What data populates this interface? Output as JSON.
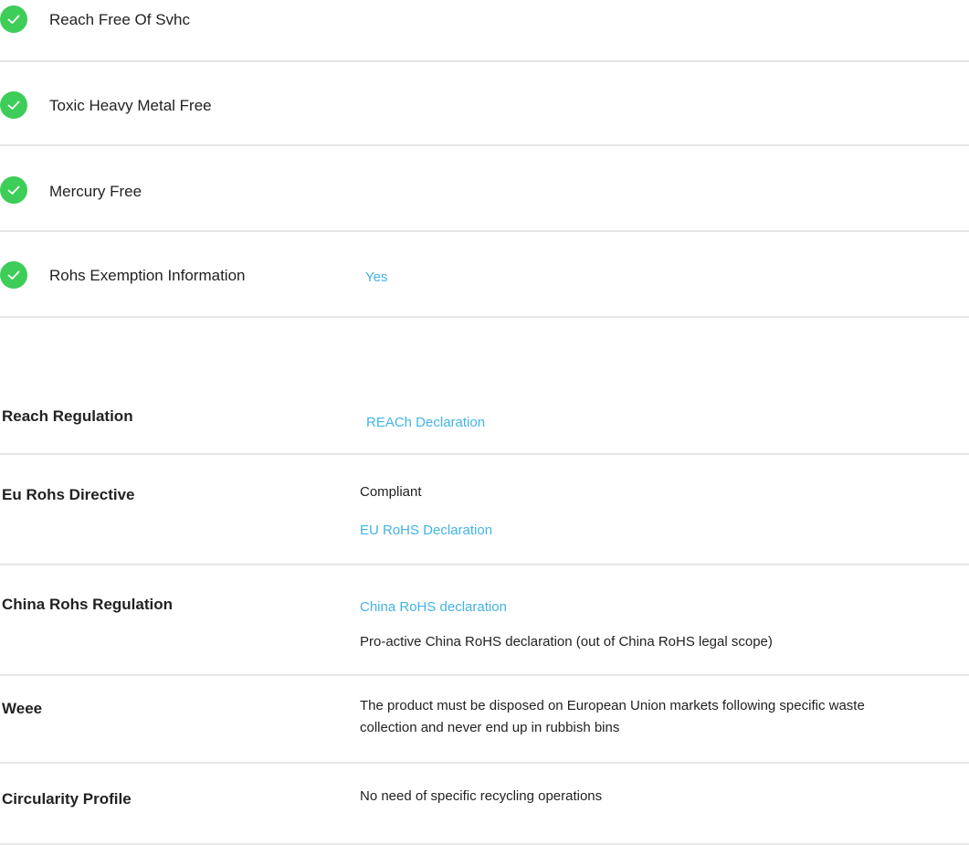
{
  "colors": {
    "accent_green": "#3dcd58",
    "link_blue": "#42b4e6",
    "divider": "#e6e6e6",
    "text": "#222222"
  },
  "checklist": [
    {
      "icon": "check-circle-icon",
      "label": "Reach Free Of Svhc",
      "value": ""
    },
    {
      "icon": "check-circle-icon",
      "label": "Toxic Heavy Metal Free",
      "value": ""
    },
    {
      "icon": "check-circle-icon",
      "label": "Mercury Free",
      "value": ""
    },
    {
      "icon": "check-circle-icon",
      "label": "Rohs Exemption Information",
      "value": "Yes"
    }
  ],
  "regulations": {
    "reach": {
      "label": "Reach Regulation",
      "link": "REACh Declaration"
    },
    "eu_rohs": {
      "label": "Eu Rohs Directive",
      "status": "Compliant",
      "link": "EU RoHS Declaration"
    },
    "china_rohs": {
      "label": "China Rohs Regulation",
      "link": "China RoHS declaration",
      "note": "Pro-active China RoHS declaration (out of China RoHS legal scope)"
    },
    "weee": {
      "label": "Weee",
      "line1": "The product must be disposed on European Union markets following specific waste",
      "line2": "collection and never end up in rubbish bins"
    },
    "circularity": {
      "label": "Circularity Profile",
      "text": "No need of specific recycling operations"
    }
  }
}
